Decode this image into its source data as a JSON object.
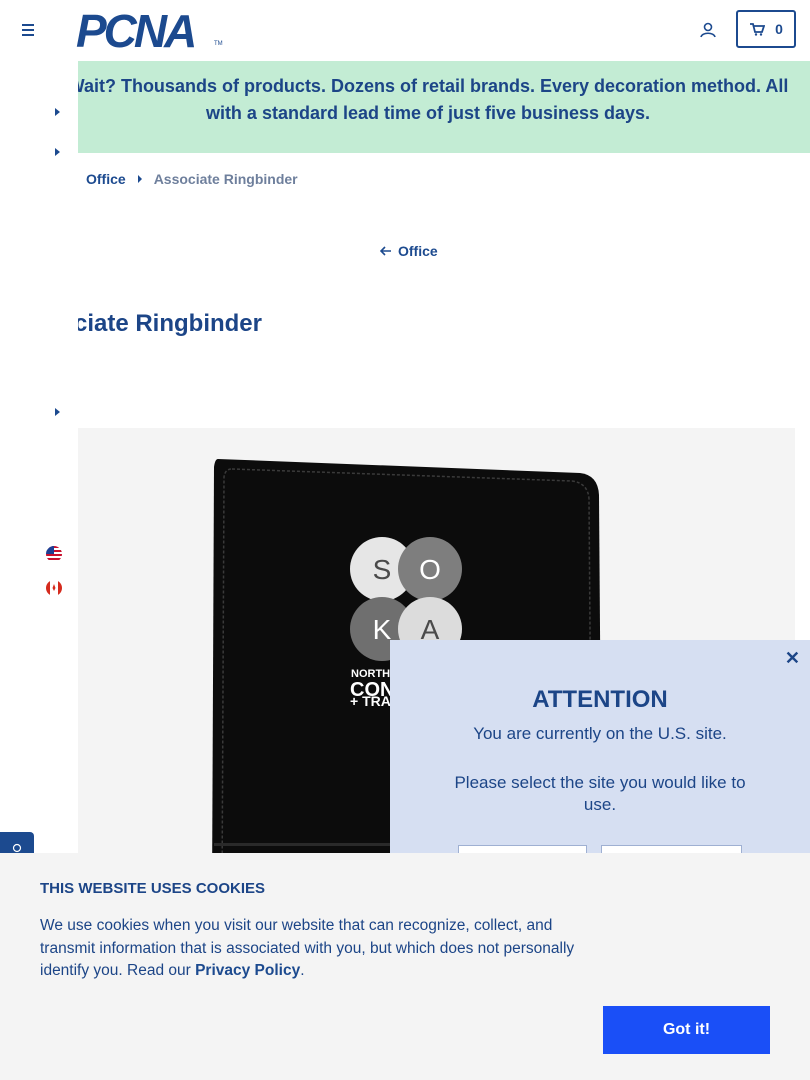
{
  "header": {
    "logo_text": "PCNA",
    "logo_tm": "TM",
    "cart_count": "0"
  },
  "banner": {
    "text": "Wait? Thousands of products. Dozens of retail brands. Every decoration method. All with a standard lead time of just five business days."
  },
  "breadcrumb": {
    "parent": "Office",
    "current": "Associate Ringbinder"
  },
  "back_link": "Office",
  "product": {
    "title": "Associate Ringbinder",
    "imprint": {
      "letters": [
        "S",
        "O",
        "K",
        "A"
      ],
      "line1": "NORTH",
      "line2": "CON",
      "line3": "+ TRA"
    }
  },
  "modal": {
    "title": "ATTENTION",
    "line1": "You are currently on the U.S. site.",
    "line2": "Please select the site you would like to use."
  },
  "cookie": {
    "title": "THIS WEBSITE USES COOKIES",
    "text": "We use cookies when you visit our website that can recognize, collect, and transmit information that is associated with you, but which does not personally identify you. Read our ",
    "link": "Privacy Policy",
    "period": ".",
    "button": "Got it!"
  },
  "colors": {
    "brand_blue": "#1c4587",
    "banner_green": "#c3ecd4",
    "modal_bg": "#d6dff2",
    "cta_blue": "#1a4ff7"
  },
  "icons": [
    "menu-icon",
    "user-icon",
    "cart-icon",
    "caret-right-icon",
    "arrow-left-icon",
    "us-flag-icon",
    "canada-flag-icon",
    "close-icon"
  ]
}
